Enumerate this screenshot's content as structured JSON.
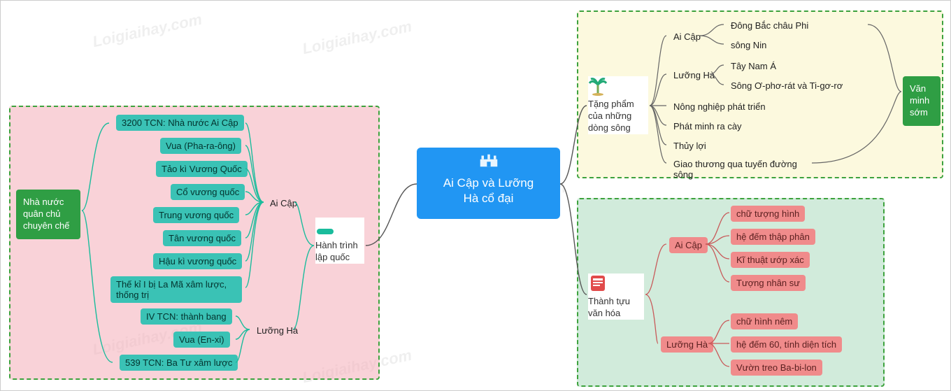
{
  "watermark": "Loigiaihay.com",
  "central": {
    "title": "Ai Cập và Lưỡng Hà cổ đại",
    "icon": "castle-icon"
  },
  "left": {
    "side_label": "Nhà nước quân chủ chuyên chế",
    "branch": {
      "label": "Hành trình lập quốc",
      "icon": "flag-icon"
    },
    "group_a": {
      "label": "Ai Cập",
      "items": [
        "3200 TCN: Nhà nước Ai Cập",
        "Vua (Pha-ra-ông)",
        "Tảo kì Vương Quốc",
        "Cổ vương quốc",
        "Trung vương quốc",
        "Tân vương quốc",
        "Hậu kì vương quốc",
        "Thế kỉ I bị La Mã xâm lược, thống trị"
      ]
    },
    "group_b": {
      "label": "Lưỡng Hà",
      "items": [
        "IV TCN: thành bang",
        "Vua (En-xi)",
        "539 TCN: Ba Tư xâm lược"
      ]
    }
  },
  "top_right": {
    "side_label": "Văn minh sớm",
    "branch": {
      "label": "Tặng phẩm của những dòng sông",
      "icon": "palm-icon"
    },
    "group_a": {
      "label": "Ai Cập",
      "items": [
        "Đông Bắc châu Phi",
        "sông Nin"
      ]
    },
    "group_b": {
      "label": "Lưỡng Hà",
      "items": [
        "Tây Nam Á",
        "Sông Ơ-phơ-rát và Ti-gơ-rơ"
      ]
    },
    "extra": [
      "Nông nghiệp phát triển",
      "Phát minh ra cày",
      "Thủy lợi",
      "Giao thương qua tuyến đường sông"
    ]
  },
  "bottom_right": {
    "branch": {
      "label": "Thành tựu văn hóa",
      "icon": "scroll-icon"
    },
    "group_a": {
      "label": "Ai Cập",
      "items": [
        "chữ tượng hình",
        "hệ đếm thập phân",
        "Kĩ thuật ướp xác",
        "Tượng nhân sư"
      ]
    },
    "group_b": {
      "label": "Lưỡng Hà",
      "items": [
        "chữ hình nêm",
        "hệ đếm 60, tính diện tích",
        "Vườn treo Ba-bi-lon"
      ]
    }
  }
}
